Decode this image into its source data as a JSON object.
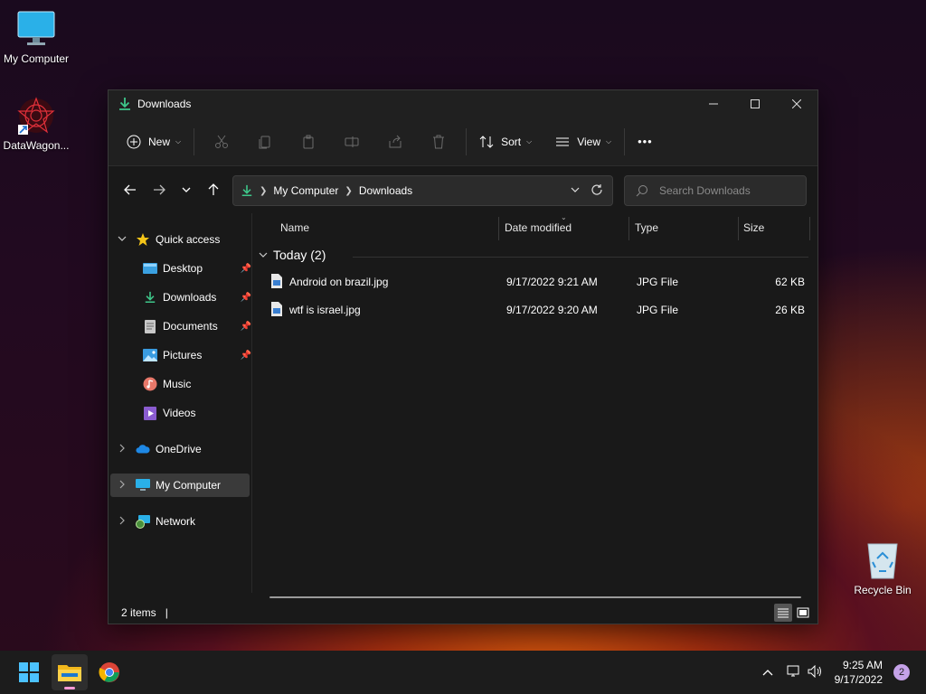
{
  "desktop": {
    "icons": [
      {
        "label": "My Computer"
      },
      {
        "label": "DataWagon..."
      },
      {
        "label": "Recycle Bin"
      }
    ]
  },
  "window": {
    "title": "Downloads",
    "toolbar": {
      "new_label": "New",
      "sort_label": "Sort",
      "view_label": "View",
      "more_label": "•••"
    },
    "breadcrumb": [
      "My Computer",
      "Downloads"
    ],
    "search_placeholder": "Search Downloads",
    "sidebar": {
      "quick_access": "Quick access",
      "pinned": [
        {
          "label": "Desktop",
          "icon": "desktop-folder-icon"
        },
        {
          "label": "Downloads",
          "icon": "download-icon"
        },
        {
          "label": "Documents",
          "icon": "documents-icon"
        },
        {
          "label": "Pictures",
          "icon": "pictures-icon"
        },
        {
          "label": "Music",
          "icon": "music-icon"
        },
        {
          "label": "Videos",
          "icon": "videos-icon"
        }
      ],
      "onedrive": "OneDrive",
      "my_computer": "My Computer",
      "network": "Network"
    },
    "columns": {
      "name": "Name",
      "date": "Date modified",
      "type": "Type",
      "size": "Size"
    },
    "group_label": "Today (2)",
    "files": [
      {
        "name": "Android on brazil.jpg",
        "date": "9/17/2022 9:21 AM",
        "type": "JPG File",
        "size": "62 KB"
      },
      {
        "name": "wtf is israel.jpg",
        "date": "9/17/2022 9:20 AM",
        "type": "JPG File",
        "size": "26 KB"
      }
    ],
    "status": "2 items",
    "status_sep": "|"
  },
  "taskbar": {
    "time": "9:25 AM",
    "date": "9/17/2022",
    "notifications": "2"
  },
  "colors": {
    "accent": "#4cc2ff",
    "download_green": "#3ec78a",
    "selection": "#3a3a3a"
  }
}
